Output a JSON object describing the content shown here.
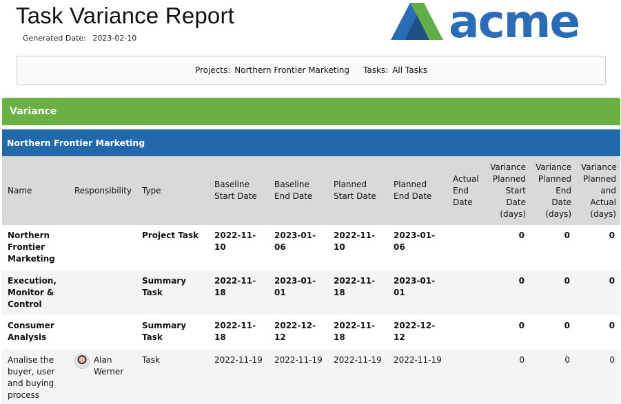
{
  "report": {
    "title": "Task Variance Report",
    "generated_label": "Generated Date:",
    "generated_value": "2023-02-10",
    "logo_text": "acme"
  },
  "filters": {
    "projects_label": "Projects:",
    "projects_value": "Northern Frontier Marketing",
    "tasks_label": "Tasks:",
    "tasks_value": "All Tasks"
  },
  "section": {
    "variance_label": "Variance",
    "project_name": "Northern Frontier Marketing"
  },
  "colors": {
    "variance_bar": "#6ab045",
    "project_bar": "#2169ab",
    "header_bg": "#d9d9d9",
    "logo_blue": "#2a6cb5",
    "logo_green": "#5fae4a"
  },
  "table": {
    "columns": [
      "Name",
      "Responsibility",
      "Type",
      "Baseline Start Date",
      "Baseline End Date",
      "Planned Start Date",
      "Planned End Date",
      "Actual End Date",
      "Variance Planned Start Date (days)",
      "Variance Planned End Date (days)",
      "Variance Planned and Actual (days)"
    ],
    "rows": [
      {
        "name": "Northern Frontier Marketing",
        "responsibility": "",
        "type": "Project Task",
        "baseline_start": "2022-11-10",
        "baseline_end": "2023-01-06",
        "planned_start": "2022-11-10",
        "planned_end": "2023-01-06",
        "actual_end": "",
        "var_start": "0",
        "var_end": "0",
        "var_actual": "0"
      },
      {
        "name": "Execution, Monitor & Control",
        "responsibility": "",
        "type": "Summary Task",
        "baseline_start": "2022-11-18",
        "baseline_end": "2023-01-01",
        "planned_start": "2022-11-18",
        "planned_end": "2023-01-01",
        "actual_end": "",
        "var_start": "0",
        "var_end": "0",
        "var_actual": "0"
      },
      {
        "name": "Consumer Analysis",
        "responsibility": "",
        "type": "Summary Task",
        "baseline_start": "2022-11-18",
        "baseline_end": "2022-12-12",
        "planned_start": "2022-11-18",
        "planned_end": "2022-12-12",
        "actual_end": "",
        "var_start": "0",
        "var_end": "0",
        "var_actual": "0"
      },
      {
        "name": "Analise the buyer, user and buying process",
        "responsibility": "Alan Werner",
        "type": "Task",
        "baseline_start": "2022-11-19",
        "baseline_end": "2022-11-19",
        "planned_start": "2022-11-19",
        "planned_end": "2022-11-19",
        "actual_end": "",
        "var_start": "0",
        "var_end": "0",
        "var_actual": "0"
      }
    ]
  }
}
